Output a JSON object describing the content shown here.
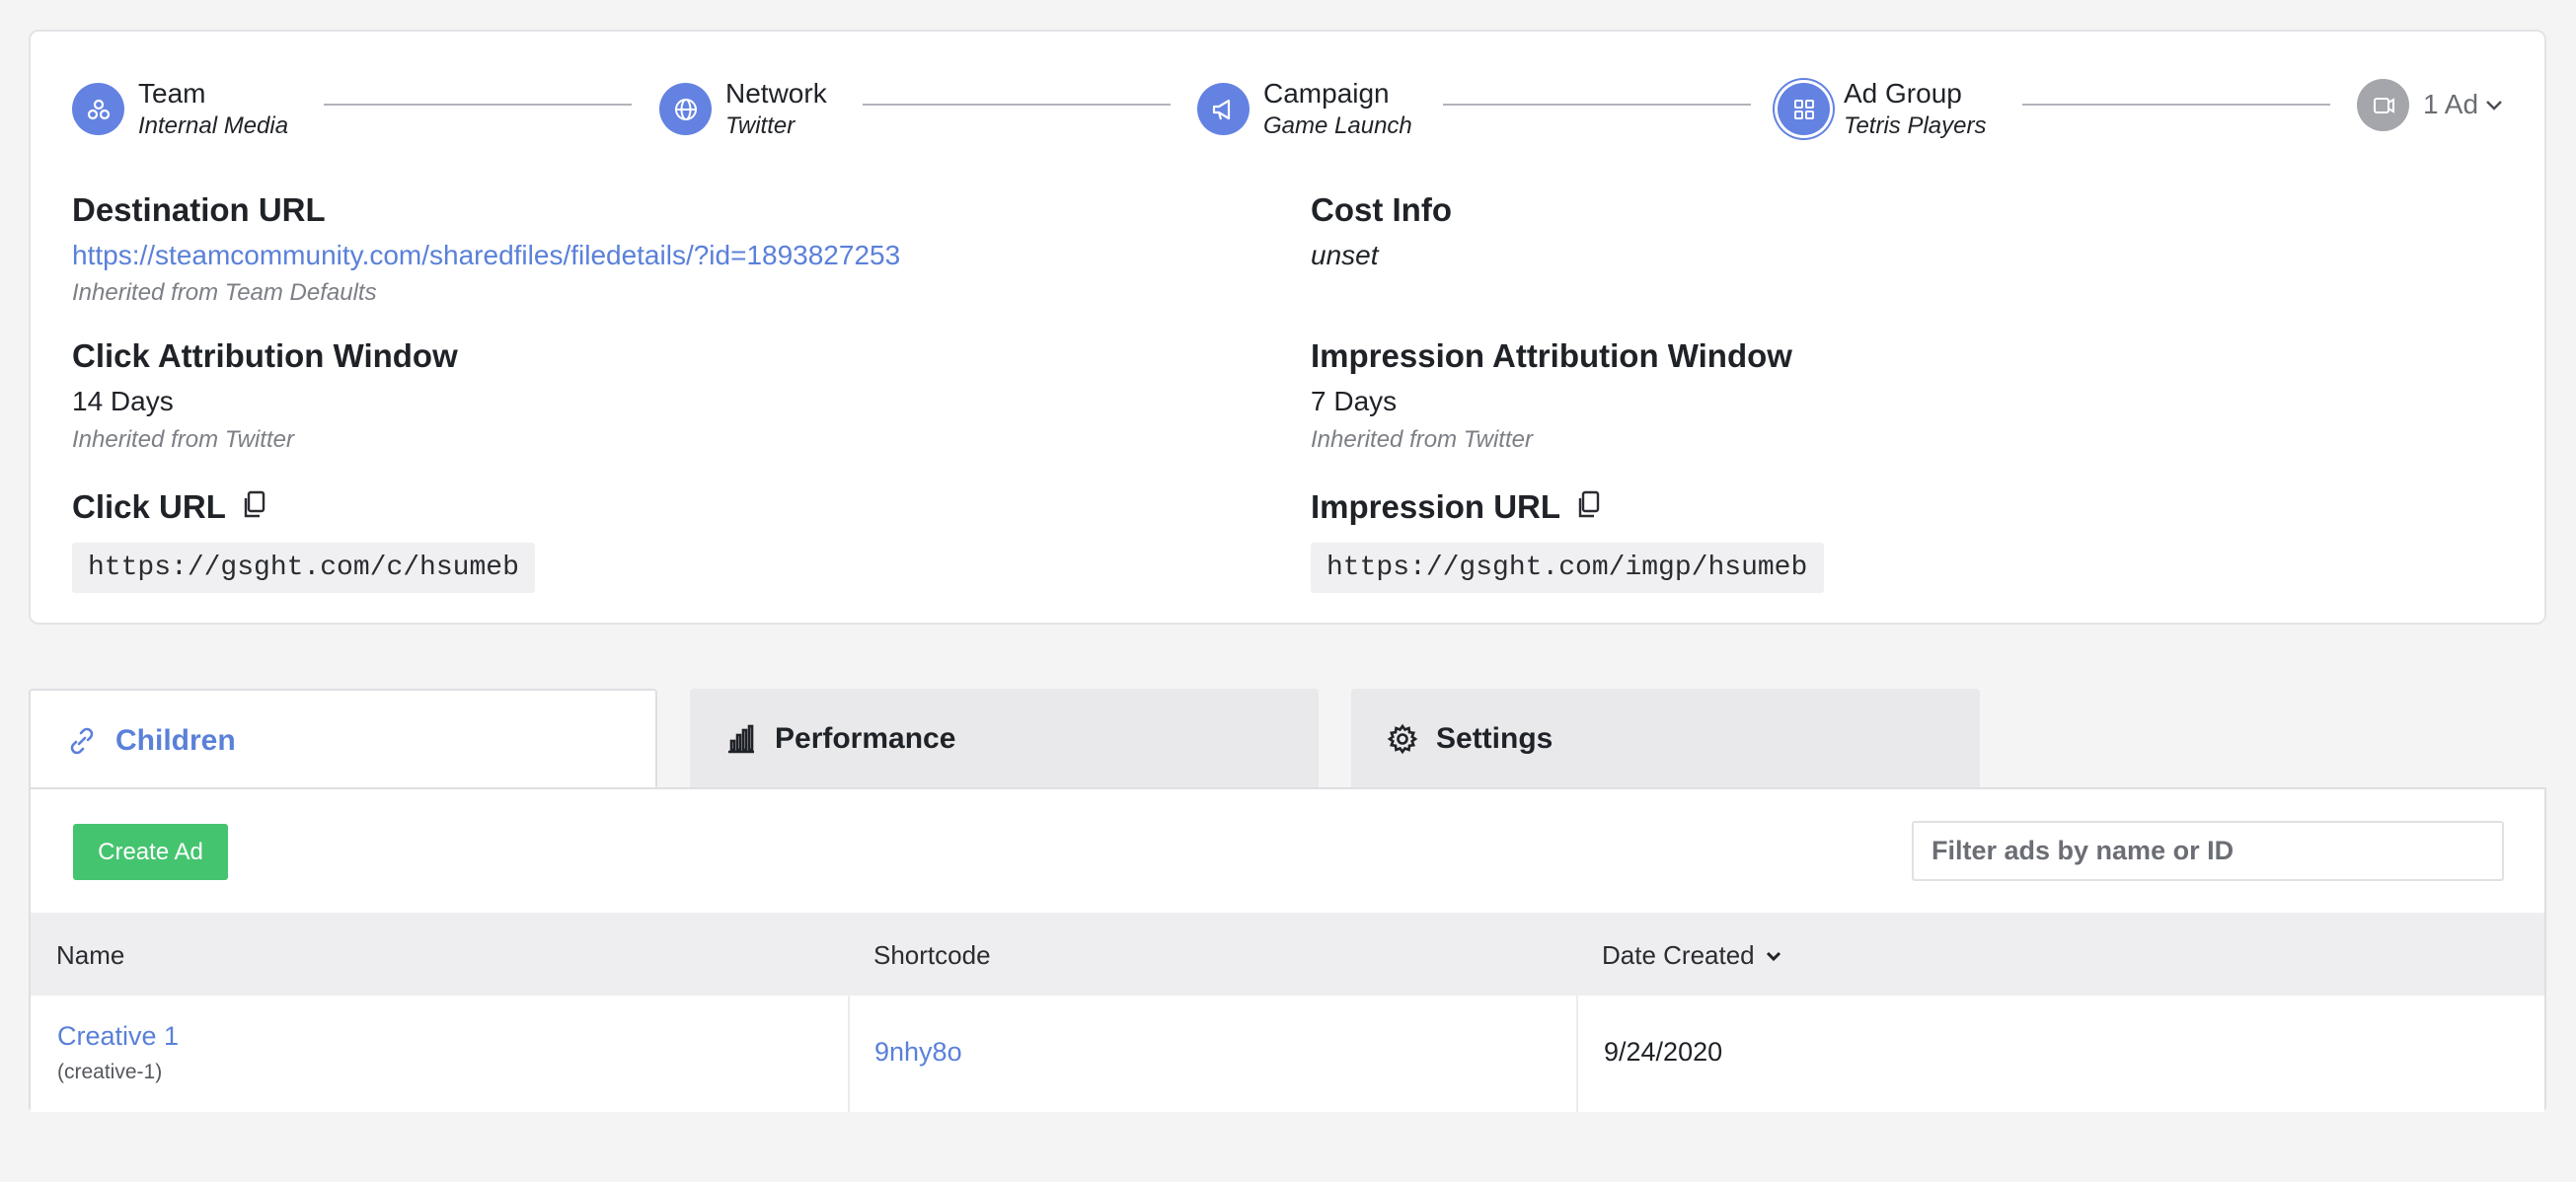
{
  "steps": [
    {
      "title": "Team",
      "subtitle": "Internal Media",
      "icon": "team-icon"
    },
    {
      "title": "Network",
      "subtitle": "Twitter",
      "icon": "globe-icon"
    },
    {
      "title": "Campaign",
      "subtitle": "Game Launch",
      "icon": "megaphone-icon"
    },
    {
      "title": "Ad Group",
      "subtitle": "Tetris Players",
      "icon": "grid-icon"
    },
    {
      "title": "1 Ad",
      "icon": "ad-icon"
    }
  ],
  "details": {
    "destination_url": {
      "label": "Destination URL",
      "value": "https://steamcommunity.com/sharedfiles/filedetails/?id=1893827253",
      "note": "Inherited from Team Defaults"
    },
    "cost_info": {
      "label": "Cost Info",
      "value": "unset"
    },
    "click_window": {
      "label": "Click Attribution Window",
      "value": "14 Days",
      "note": "Inherited from Twitter"
    },
    "impression_window": {
      "label": "Impression Attribution Window",
      "value": "7 Days",
      "note": "Inherited from Twitter"
    },
    "click_url": {
      "label": "Click URL",
      "value": "https://gsght.com/c/hsumeb"
    },
    "impression_url": {
      "label": "Impression URL",
      "value": "https://gsght.com/imgp/hsumeb"
    }
  },
  "tabs": [
    {
      "label": "Children",
      "icon": "link-icon",
      "active": true
    },
    {
      "label": "Performance",
      "icon": "bar-chart-icon",
      "active": false
    },
    {
      "label": "Settings",
      "icon": "gear-icon",
      "active": false
    }
  ],
  "toolbar": {
    "create_label": "Create Ad",
    "filter_placeholder": "Filter ads by name or ID"
  },
  "table": {
    "columns": [
      "Name",
      "Shortcode",
      "Date Created"
    ],
    "rows": [
      {
        "name": "Creative 1",
        "slug": "(creative-1)",
        "shortcode": "9nhy8o",
        "date": "9/24/2020"
      }
    ]
  },
  "colors": {
    "accent": "#5a80d9",
    "step_circle": "#6382e2",
    "create_button": "#45c46f",
    "muted_circle": "#a4a6ab"
  }
}
